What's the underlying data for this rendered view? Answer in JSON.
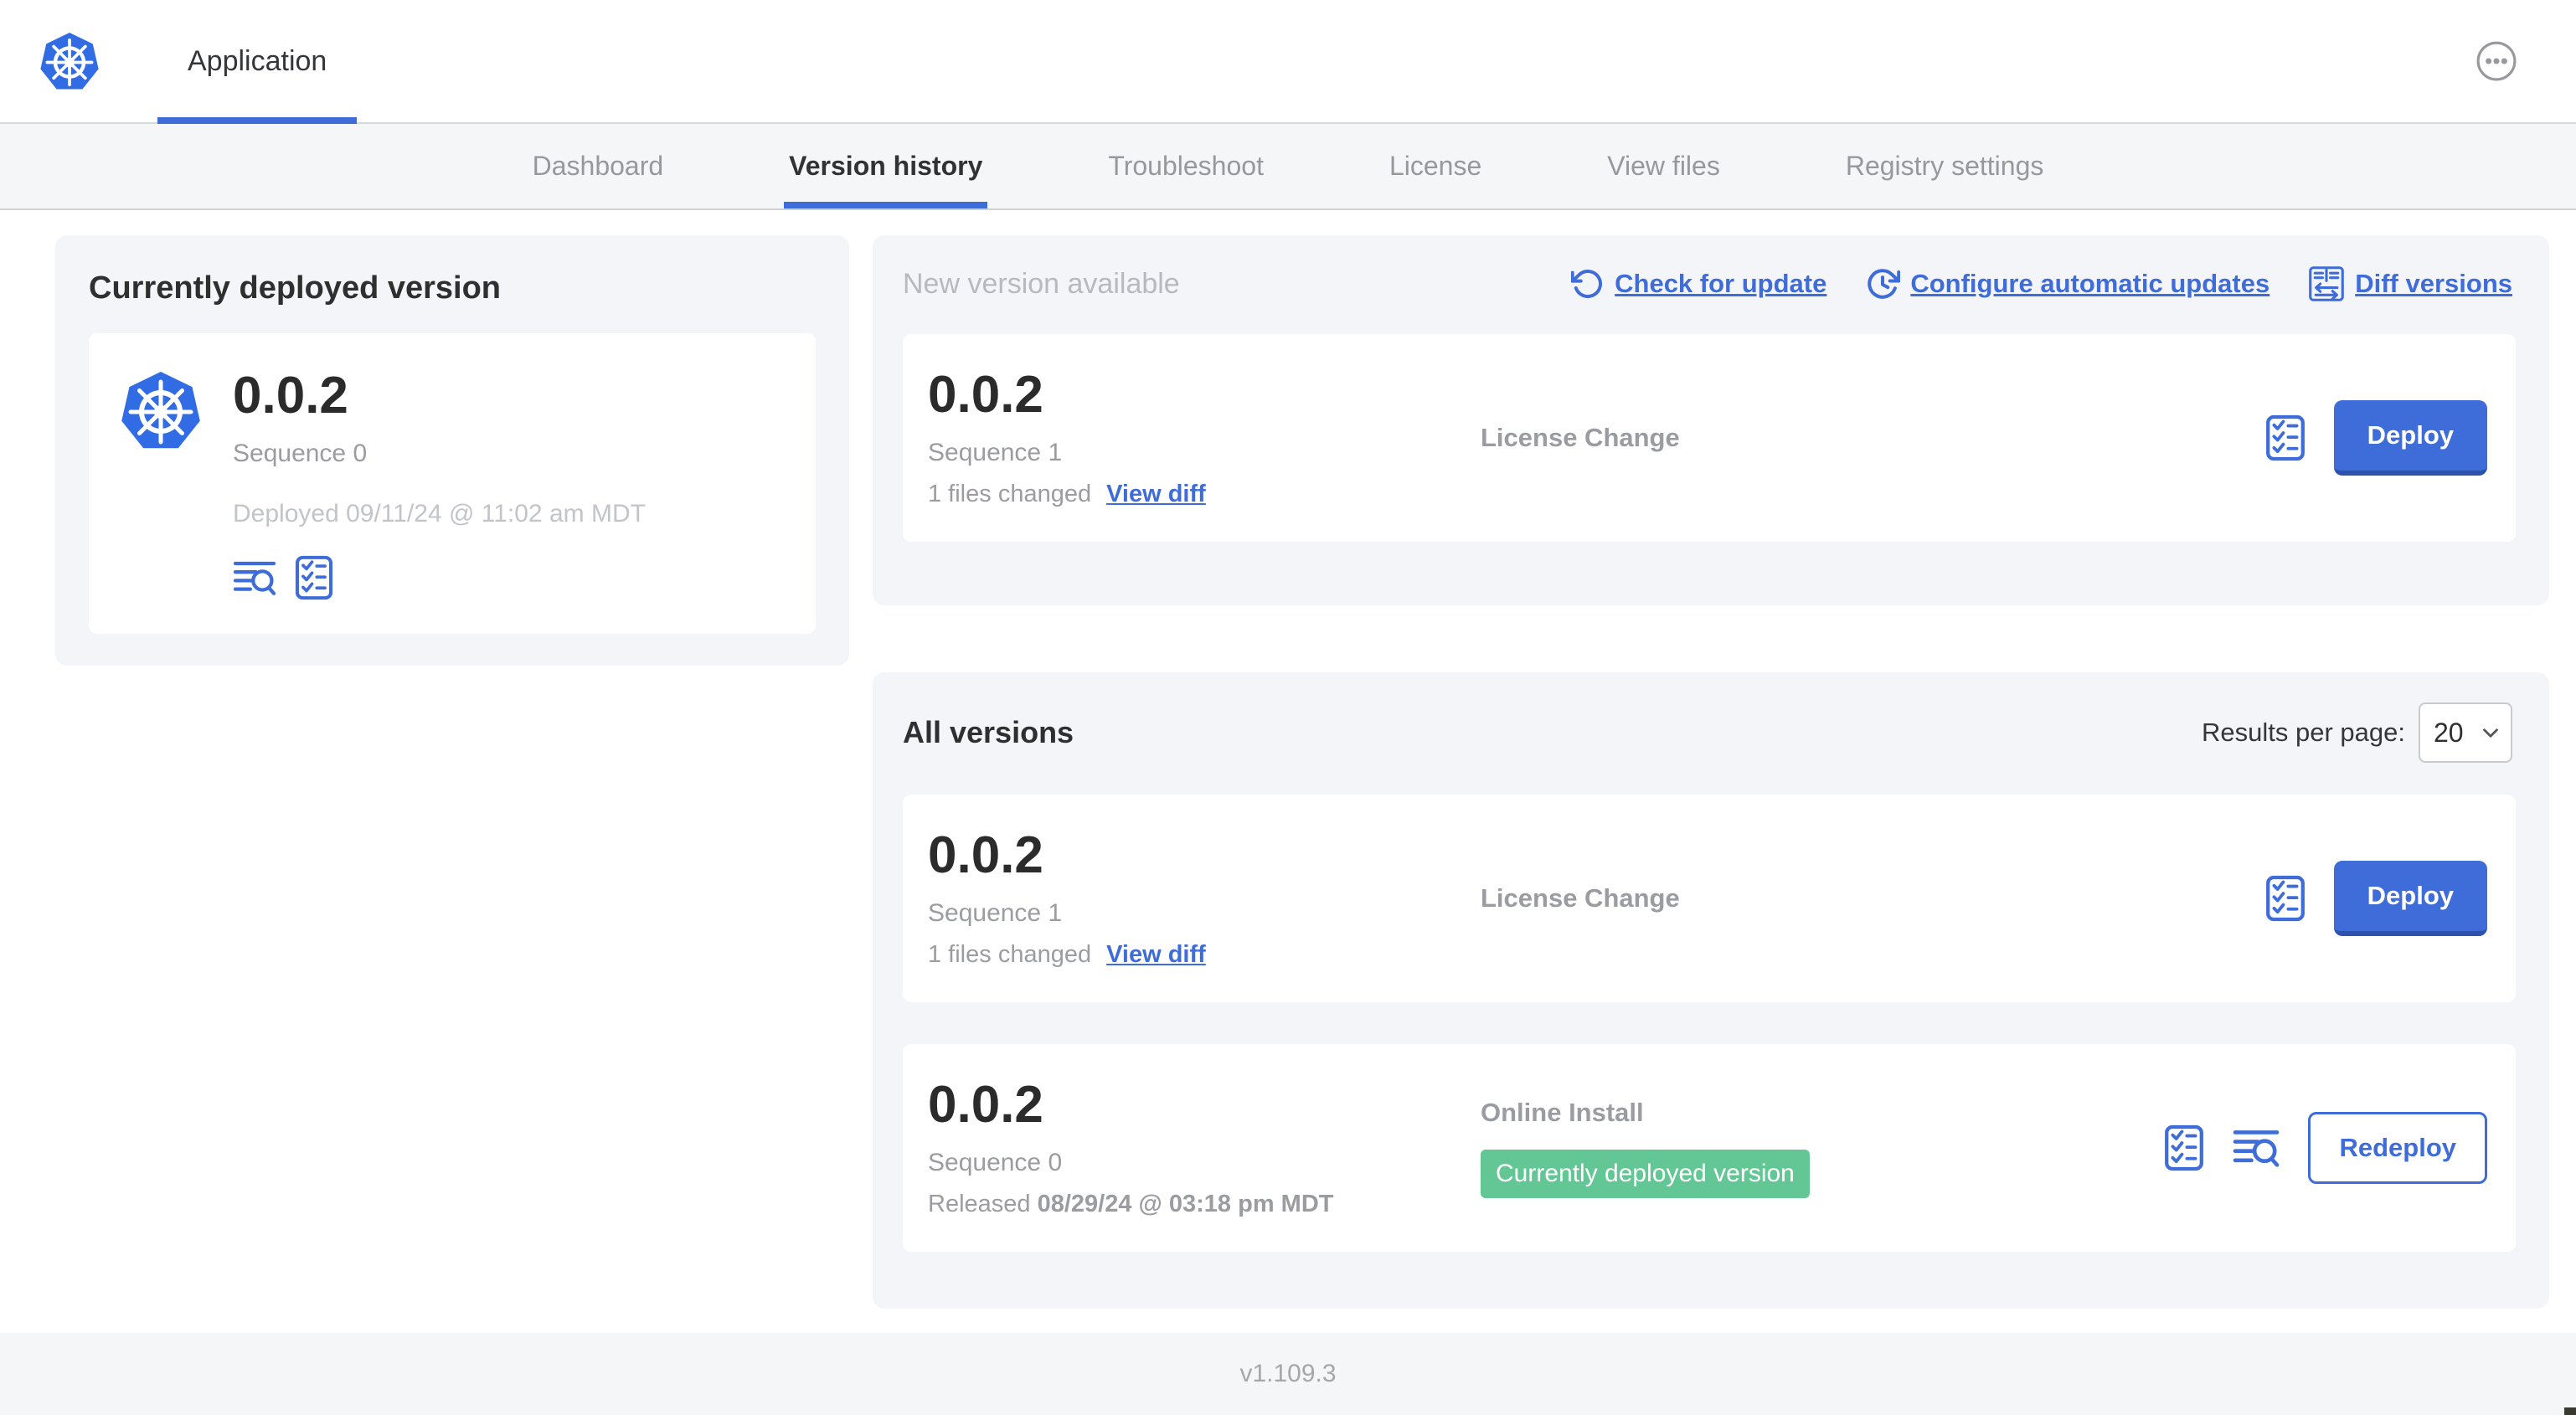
{
  "header": {
    "app_tab": "Application"
  },
  "nav": {
    "tabs": [
      {
        "label": "Dashboard"
      },
      {
        "label": "Version history"
      },
      {
        "label": "Troubleshoot"
      },
      {
        "label": "License"
      },
      {
        "label": "View files"
      },
      {
        "label": "Registry settings"
      }
    ],
    "active_tab": "Version history"
  },
  "deployed_card": {
    "title": "Currently deployed version",
    "version": "0.0.2",
    "sequence": "Sequence 0",
    "deployed_at": "Deployed 09/11/24 @ 11:02 am MDT"
  },
  "new_version": {
    "title": "New version available",
    "actions": {
      "check": "Check for update",
      "configure": "Configure automatic updates",
      "diff": "Diff versions"
    },
    "row": {
      "version": "0.0.2",
      "sequence": "Sequence 1",
      "files_changed": "1 files changed",
      "view_diff": "View diff",
      "source": "License Change",
      "action": "Deploy"
    }
  },
  "all_versions": {
    "title": "All versions",
    "results_label": "Results per page:",
    "results_value": "20",
    "rows": [
      {
        "version": "0.0.2",
        "sequence": "Sequence 1",
        "files_changed": "1 files changed",
        "view_diff": "View diff",
        "source": "License Change",
        "action": "Deploy"
      },
      {
        "version": "0.0.2",
        "sequence": "Sequence 0",
        "released_prefix": "Released ",
        "released_date": "08/29/24 @ 03:18 pm MDT",
        "source": "Online Install",
        "badge": "Currently deployed version",
        "action": "Redeploy"
      }
    ]
  },
  "footer": {
    "app_version": "v1.109.3"
  },
  "colors": {
    "accent_blue": "#3E6CD9",
    "accent_blue_dark": "#2C52AE",
    "k8s_blue": "#326CE5",
    "badge_green": "#63C795",
    "text_dark": "#323232",
    "text_gray": "#9B9CA1",
    "text_light_gray": "#C3C4C9",
    "panel_bg": "#F4F5F8",
    "border": "#D6D8DB"
  }
}
